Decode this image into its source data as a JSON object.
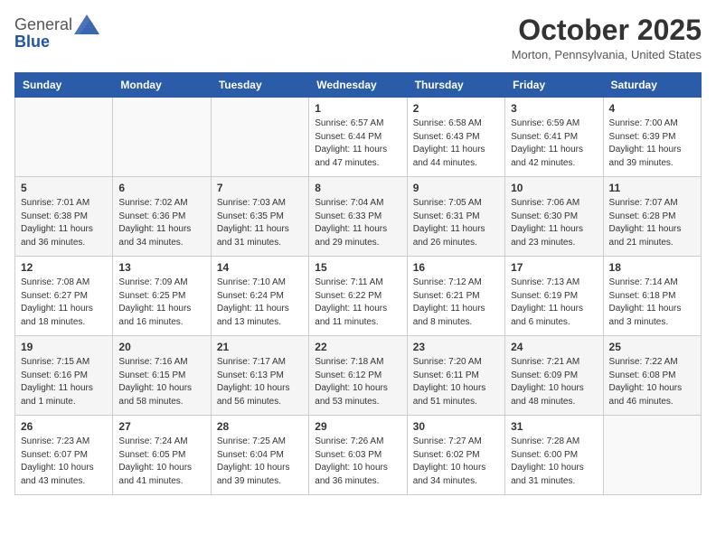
{
  "header": {
    "logo_general": "General",
    "logo_blue": "Blue",
    "month_title": "October 2025",
    "location": "Morton, Pennsylvania, United States"
  },
  "days_of_week": [
    "Sunday",
    "Monday",
    "Tuesday",
    "Wednesday",
    "Thursday",
    "Friday",
    "Saturday"
  ],
  "weeks": [
    [
      {
        "day": "",
        "info": ""
      },
      {
        "day": "",
        "info": ""
      },
      {
        "day": "",
        "info": ""
      },
      {
        "day": "1",
        "info": "Sunrise: 6:57 AM\nSunset: 6:44 PM\nDaylight: 11 hours\nand 47 minutes."
      },
      {
        "day": "2",
        "info": "Sunrise: 6:58 AM\nSunset: 6:43 PM\nDaylight: 11 hours\nand 44 minutes."
      },
      {
        "day": "3",
        "info": "Sunrise: 6:59 AM\nSunset: 6:41 PM\nDaylight: 11 hours\nand 42 minutes."
      },
      {
        "day": "4",
        "info": "Sunrise: 7:00 AM\nSunset: 6:39 PM\nDaylight: 11 hours\nand 39 minutes."
      }
    ],
    [
      {
        "day": "5",
        "info": "Sunrise: 7:01 AM\nSunset: 6:38 PM\nDaylight: 11 hours\nand 36 minutes."
      },
      {
        "day": "6",
        "info": "Sunrise: 7:02 AM\nSunset: 6:36 PM\nDaylight: 11 hours\nand 34 minutes."
      },
      {
        "day": "7",
        "info": "Sunrise: 7:03 AM\nSunset: 6:35 PM\nDaylight: 11 hours\nand 31 minutes."
      },
      {
        "day": "8",
        "info": "Sunrise: 7:04 AM\nSunset: 6:33 PM\nDaylight: 11 hours\nand 29 minutes."
      },
      {
        "day": "9",
        "info": "Sunrise: 7:05 AM\nSunset: 6:31 PM\nDaylight: 11 hours\nand 26 minutes."
      },
      {
        "day": "10",
        "info": "Sunrise: 7:06 AM\nSunset: 6:30 PM\nDaylight: 11 hours\nand 23 minutes."
      },
      {
        "day": "11",
        "info": "Sunrise: 7:07 AM\nSunset: 6:28 PM\nDaylight: 11 hours\nand 21 minutes."
      }
    ],
    [
      {
        "day": "12",
        "info": "Sunrise: 7:08 AM\nSunset: 6:27 PM\nDaylight: 11 hours\nand 18 minutes."
      },
      {
        "day": "13",
        "info": "Sunrise: 7:09 AM\nSunset: 6:25 PM\nDaylight: 11 hours\nand 16 minutes."
      },
      {
        "day": "14",
        "info": "Sunrise: 7:10 AM\nSunset: 6:24 PM\nDaylight: 11 hours\nand 13 minutes."
      },
      {
        "day": "15",
        "info": "Sunrise: 7:11 AM\nSunset: 6:22 PM\nDaylight: 11 hours\nand 11 minutes."
      },
      {
        "day": "16",
        "info": "Sunrise: 7:12 AM\nSunset: 6:21 PM\nDaylight: 11 hours\nand 8 minutes."
      },
      {
        "day": "17",
        "info": "Sunrise: 7:13 AM\nSunset: 6:19 PM\nDaylight: 11 hours\nand 6 minutes."
      },
      {
        "day": "18",
        "info": "Sunrise: 7:14 AM\nSunset: 6:18 PM\nDaylight: 11 hours\nand 3 minutes."
      }
    ],
    [
      {
        "day": "19",
        "info": "Sunrise: 7:15 AM\nSunset: 6:16 PM\nDaylight: 11 hours\nand 1 minute."
      },
      {
        "day": "20",
        "info": "Sunrise: 7:16 AM\nSunset: 6:15 PM\nDaylight: 10 hours\nand 58 minutes."
      },
      {
        "day": "21",
        "info": "Sunrise: 7:17 AM\nSunset: 6:13 PM\nDaylight: 10 hours\nand 56 minutes."
      },
      {
        "day": "22",
        "info": "Sunrise: 7:18 AM\nSunset: 6:12 PM\nDaylight: 10 hours\nand 53 minutes."
      },
      {
        "day": "23",
        "info": "Sunrise: 7:20 AM\nSunset: 6:11 PM\nDaylight: 10 hours\nand 51 minutes."
      },
      {
        "day": "24",
        "info": "Sunrise: 7:21 AM\nSunset: 6:09 PM\nDaylight: 10 hours\nand 48 minutes."
      },
      {
        "day": "25",
        "info": "Sunrise: 7:22 AM\nSunset: 6:08 PM\nDaylight: 10 hours\nand 46 minutes."
      }
    ],
    [
      {
        "day": "26",
        "info": "Sunrise: 7:23 AM\nSunset: 6:07 PM\nDaylight: 10 hours\nand 43 minutes."
      },
      {
        "day": "27",
        "info": "Sunrise: 7:24 AM\nSunset: 6:05 PM\nDaylight: 10 hours\nand 41 minutes."
      },
      {
        "day": "28",
        "info": "Sunrise: 7:25 AM\nSunset: 6:04 PM\nDaylight: 10 hours\nand 39 minutes."
      },
      {
        "day": "29",
        "info": "Sunrise: 7:26 AM\nSunset: 6:03 PM\nDaylight: 10 hours\nand 36 minutes."
      },
      {
        "day": "30",
        "info": "Sunrise: 7:27 AM\nSunset: 6:02 PM\nDaylight: 10 hours\nand 34 minutes."
      },
      {
        "day": "31",
        "info": "Sunrise: 7:28 AM\nSunset: 6:00 PM\nDaylight: 10 hours\nand 31 minutes."
      },
      {
        "day": "",
        "info": ""
      }
    ]
  ]
}
